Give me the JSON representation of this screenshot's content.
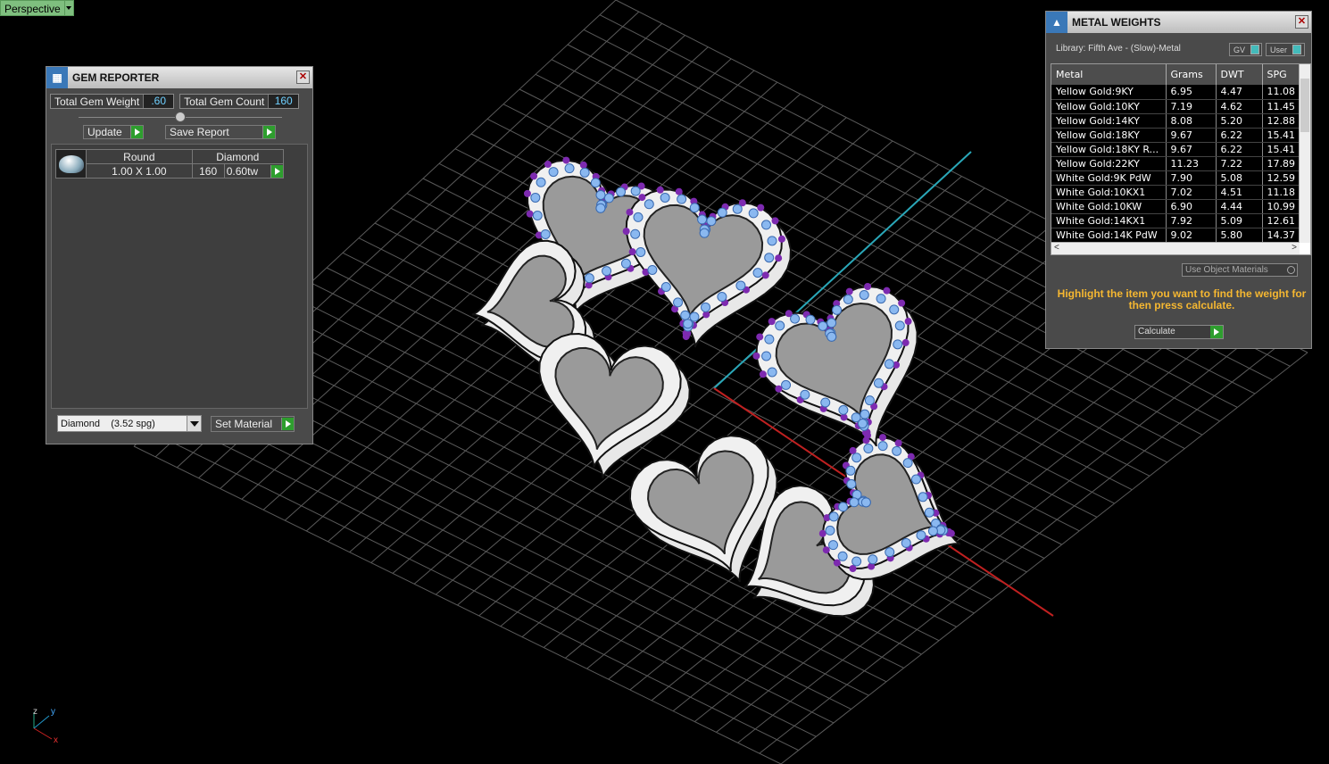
{
  "viewport": {
    "label": "Perspective"
  },
  "gem_reporter": {
    "title": "GEM REPORTER",
    "total_gem_weight_label": "Total Gem Weight",
    "total_gem_weight": ".60",
    "total_gem_count_label": "Total Gem Count",
    "total_gem_count": "160",
    "update_label": "Update",
    "save_report_label": "Save Report",
    "gem": {
      "shape": "Round",
      "material": "Diamond",
      "size": "1.00 X 1.00",
      "count": "160",
      "weight": "0.60tw"
    },
    "material_select": "Diamond    (3.52 spg)",
    "set_material_label": "Set Material"
  },
  "metal_weights": {
    "title": "METAL WEIGHTS",
    "library": "Library: Fifth Ave - (Slow)-Metal",
    "gv_label": "GV",
    "user_label": "User",
    "columns": [
      "Metal",
      "Grams",
      "DWT",
      "SPG"
    ],
    "rows": [
      [
        "Yellow Gold:9KY",
        "6.95",
        "4.47",
        "11.08"
      ],
      [
        "Yellow Gold:10KY",
        "7.19",
        "4.62",
        "11.45"
      ],
      [
        "Yellow Gold:14KY",
        "8.08",
        "5.20",
        "12.88"
      ],
      [
        "Yellow Gold:18KY",
        "9.67",
        "6.22",
        "15.41"
      ],
      [
        "Yellow Gold:18KY R...",
        "9.67",
        "6.22",
        "15.41"
      ],
      [
        "Yellow Gold:22KY",
        "11.23",
        "7.22",
        "17.89"
      ],
      [
        "White Gold:9K PdW",
        "7.90",
        "5.08",
        "12.59"
      ],
      [
        "White Gold:10KX1",
        "7.02",
        "4.51",
        "11.18"
      ],
      [
        "White Gold:10KW",
        "6.90",
        "4.44",
        "10.99"
      ],
      [
        "White Gold:14KX1",
        "7.92",
        "5.09",
        "12.61"
      ],
      [
        "White Gold:14K PdW",
        "9.02",
        "5.80",
        "14.37"
      ]
    ],
    "use_object_materials": "Use Object Materials",
    "hint": "Highlight the item you want to find the weight for then press calculate.",
    "calculate_label": "Calculate"
  },
  "gizmo": {
    "z": "z",
    "y": "y",
    "x": "x"
  }
}
